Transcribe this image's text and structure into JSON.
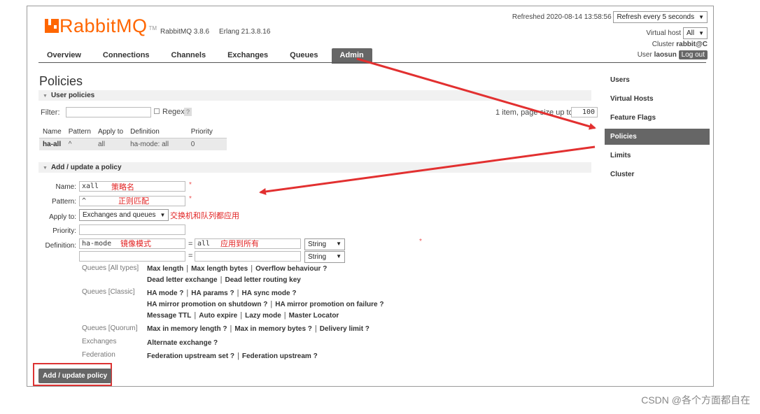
{
  "header": {
    "logo_name": "Rabbit",
    "logo_mq": "MQ",
    "logo_tm": "TM",
    "rabbitmq_version": "RabbitMQ 3.8.6",
    "erlang_version": "Erlang 21.3.8.16",
    "refreshed": "Refreshed 2020-08-14 13:58:56",
    "refresh_select": "Refresh every 5 seconds",
    "virtual_host_label": "Virtual host",
    "virtual_host_value": "All",
    "cluster_label": "Cluster",
    "cluster_value": "rabbit@C",
    "user_label": "User",
    "user_value": "laosun",
    "logout": "Log out"
  },
  "nav": {
    "tabs": [
      "Overview",
      "Connections",
      "Channels",
      "Exchanges",
      "Queues",
      "Admin"
    ],
    "active": "Admin"
  },
  "side_menu": {
    "items": [
      "Users",
      "Virtual Hosts",
      "Feature Flags",
      "Policies",
      "Limits",
      "Cluster"
    ],
    "active": "Policies"
  },
  "page": {
    "title": "Policies",
    "user_policies": "User policies",
    "filter_label": "Filter:",
    "regex_label": "Regex",
    "qmark": "?",
    "pagination_text": "1 item, page size up to",
    "page_size": "100"
  },
  "policies_table": {
    "headers": [
      "Name",
      "Pattern",
      "Apply to",
      "Definition",
      "Priority"
    ],
    "rows": [
      {
        "name": "ha-all",
        "pattern": "^",
        "apply_to": "all",
        "def_key": "ha-mode:",
        "def_val": "all",
        "priority": "0"
      }
    ]
  },
  "form": {
    "section": "Add / update a policy",
    "name_label": "Name:",
    "name_value": "xall",
    "name_note": "策略名",
    "pattern_label": "Pattern:",
    "pattern_value": "^",
    "pattern_note": "正则匹配",
    "apply_label": "Apply to:",
    "apply_value": "Exchanges and queues",
    "apply_note": "交换机和队列都应用",
    "priority_label": "Priority:",
    "definition_label": "Definition:",
    "def_key": "ha-mode",
    "def_key_note": "镜像模式",
    "equals": "=",
    "def_value": "all",
    "def_value_note": "应用到所有",
    "type_1": "String",
    "type_2": "String",
    "required": "*",
    "submit": "Add / update policy"
  },
  "options": [
    {
      "category": "Queues [All types]",
      "lines": [
        [
          "Max length",
          "Max length bytes",
          "Overflow behaviour ?"
        ],
        [
          "Dead letter exchange",
          "Dead letter routing key"
        ]
      ]
    },
    {
      "category": "Queues [Classic]",
      "lines": [
        [
          "HA mode ?",
          "HA params ?",
          "HA sync mode ?"
        ],
        [
          "HA mirror promotion on shutdown ?",
          "HA mirror promotion on failure ?"
        ],
        [
          "Message TTL",
          "Auto expire",
          "Lazy mode",
          "Master Locator"
        ]
      ]
    },
    {
      "category": "Queues [Quorum]",
      "lines": [
        [
          "Max in memory length ?",
          "Max in memory bytes ?",
          "Delivery limit ?"
        ]
      ]
    },
    {
      "category": "Exchanges",
      "lines": [
        [
          "Alternate exchange ?"
        ]
      ]
    },
    {
      "category": "Federation",
      "lines": [
        [
          "Federation upstream set ?",
          "Federation upstream ?"
        ]
      ]
    }
  ],
  "watermark": "CSDN @各个方面都自在",
  "colors": {
    "accent": "#ff6600",
    "nav_active": "#666666",
    "arrow": "#e23030"
  }
}
